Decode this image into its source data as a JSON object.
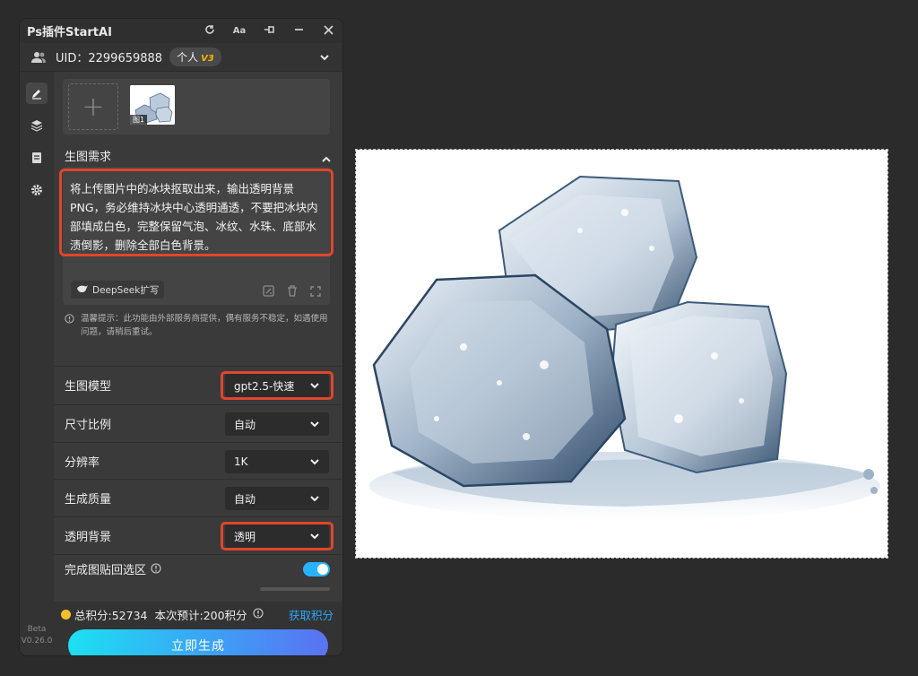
{
  "app": {
    "title": "Ps插件StartAI",
    "tools": [
      "refresh-icon",
      "font-size-icon",
      "pin-icon",
      "minimize-icon",
      "close-icon"
    ],
    "font_tool_label": "Aa"
  },
  "user": {
    "uid_text": "UID：2299659888",
    "plan_label": "个人",
    "plan_level": "V3"
  },
  "sidebar": {
    "items": [
      "edit-icon",
      "layers-icon",
      "history-icon",
      "settings-icon"
    ],
    "version_beta": "Beta",
    "version_number": "V0.26.0"
  },
  "uploader": {
    "add_symbol": "+",
    "thumb_label": "图1"
  },
  "prompt_section": {
    "title": "生图需求",
    "text": "将上传图片中的冰块抠取出来，输出透明背景PNG，务必维持冰块中心透明通透，不要把冰块内部填成白色，完整保留气泡、冰纹、水珠、底部水渍倒影，删除全部白色背景。",
    "deepseek_label": "DeepSeek扩写",
    "hint": "温馨提示：此功能由外部服务商提供，偶有服务不稳定，如遇使用问题，请稍后重试。"
  },
  "settings": {
    "model": {
      "label": "生图模型",
      "value": "gpt2.5-快速"
    },
    "ratio": {
      "label": "尺寸比例",
      "value": "自动"
    },
    "resolution": {
      "label": "分辨率",
      "value": "1K"
    },
    "quality": {
      "label": "生成质量",
      "value": "自动"
    },
    "transparent_bg": {
      "label": "透明背景",
      "value": "透明"
    },
    "paste_back": {
      "label": "完成图贴回选区",
      "enabled": true
    }
  },
  "footer": {
    "total_points": "总积分:52734",
    "estimate": "本次预计:200积分",
    "get_points": "获取积分",
    "generate": "立即生成"
  },
  "colors": {
    "accent_blue": "#27b3ff",
    "highlight_red": "#e0462c",
    "gold": "#f5b400"
  }
}
